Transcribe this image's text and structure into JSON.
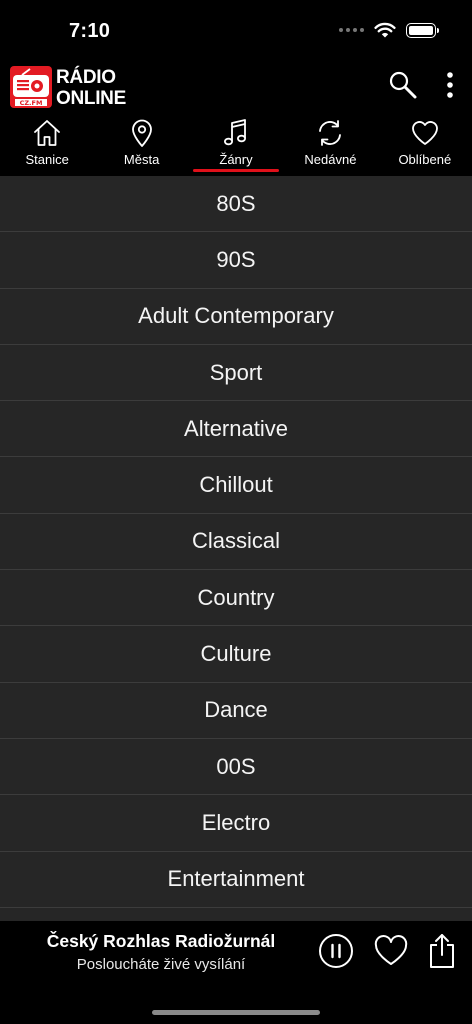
{
  "status_bar": {
    "time": "7:10"
  },
  "header": {
    "logo_line1": "RÁDIO",
    "logo_line2": "ONLINE",
    "logo_badge": "CZ.FM"
  },
  "tabs": [
    {
      "label": "Stanice",
      "icon": "home-icon"
    },
    {
      "label": "Města",
      "icon": "location-pin-icon"
    },
    {
      "label": "Žánry",
      "icon": "music-note-icon",
      "active": true
    },
    {
      "label": "Nedávné",
      "icon": "refresh-icon"
    },
    {
      "label": "Oblíbené",
      "icon": "heart-icon"
    }
  ],
  "genres": [
    "80S",
    "90S",
    "Adult Contemporary",
    "Sport",
    "Alternative",
    "Chillout",
    "Classical",
    "Country",
    "Culture",
    "Dance",
    "00S",
    "Electro",
    "Entertainment"
  ],
  "player": {
    "title": "Český Rozhlas Radiožurnál",
    "subtitle": "Posloucháte živé vysílání"
  },
  "colors": {
    "accent": "#e0101a",
    "list_bg": "#262626",
    "divider": "#3c3c3c"
  }
}
